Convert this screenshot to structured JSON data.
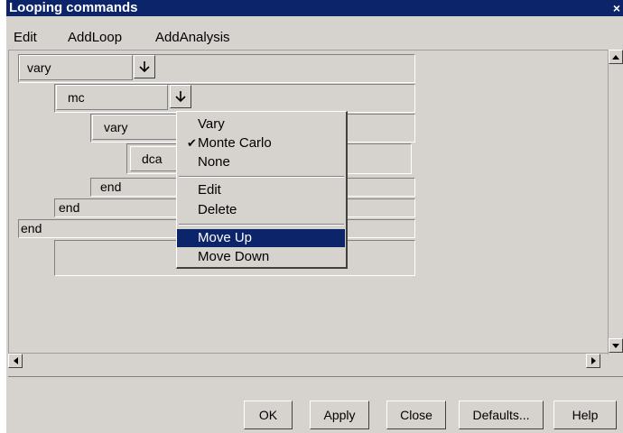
{
  "window": {
    "title": "Looping commands",
    "close_glyph": "×"
  },
  "menubar": {
    "items": [
      "Edit",
      "AddLoop",
      "AddAnalysis"
    ]
  },
  "loops": {
    "outer_vary": "vary",
    "mc": "mc",
    "inner_vary": "vary",
    "analysis": "dca",
    "end1": "end",
    "end2": "end",
    "end3": "end"
  },
  "context_menu": {
    "items": [
      {
        "label": "Vary",
        "checked": false
      },
      {
        "label": "Monte Carlo",
        "checked": true
      },
      {
        "label": "None",
        "checked": false
      },
      {
        "label": "Edit",
        "checked": false
      },
      {
        "label": "Delete",
        "checked": false
      },
      {
        "label": "Move Up",
        "selected": true
      },
      {
        "label": "Move Down",
        "checked": false
      }
    ],
    "check_glyph": "✔"
  },
  "buttons": {
    "ok": "OK",
    "apply": "Apply",
    "close": "Close",
    "defaults": "Defaults...",
    "help": "Help"
  },
  "colors": {
    "titlebar": "#0b246a",
    "face": "#d6d3ce",
    "selection": "#0b246a"
  },
  "icons": {
    "dropdown": "down-arrow-icon"
  }
}
